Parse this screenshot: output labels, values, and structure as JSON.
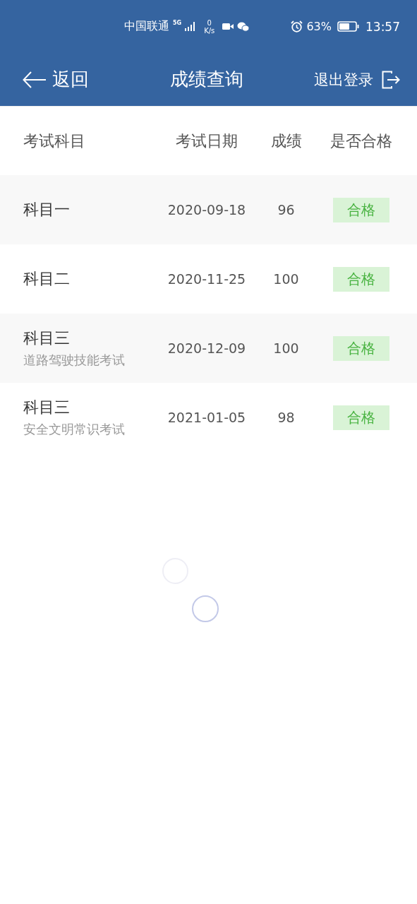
{
  "status_bar": {
    "carrier": "中国联通",
    "network": "5G",
    "speed_value": "0",
    "speed_unit": "K/s",
    "battery_percent": "63%",
    "time": "13:57"
  },
  "nav": {
    "back": "返回",
    "title": "成绩查询",
    "logout": "退出登录"
  },
  "table": {
    "columns": [
      "考试科目",
      "考试日期",
      "成绩",
      "是否合格"
    ],
    "rows": [
      {
        "subject": "科目一",
        "date": "2020-09-18",
        "score": "96",
        "result": "合格",
        "passed": true
      },
      {
        "subject": "科目二",
        "date": "2020-11-25",
        "score": "100",
        "result": "合格",
        "passed": true
      },
      {
        "subject": "科目三",
        "subtitle": "道路驾驶技能考试",
        "date": "2020-12-09",
        "score": "100",
        "result": "合格",
        "passed": true
      },
      {
        "subject": "科目三",
        "subtitle": "安全文明常识考试",
        "date": "2021-01-05",
        "score": "98",
        "result": "合格",
        "passed": true
      }
    ]
  }
}
